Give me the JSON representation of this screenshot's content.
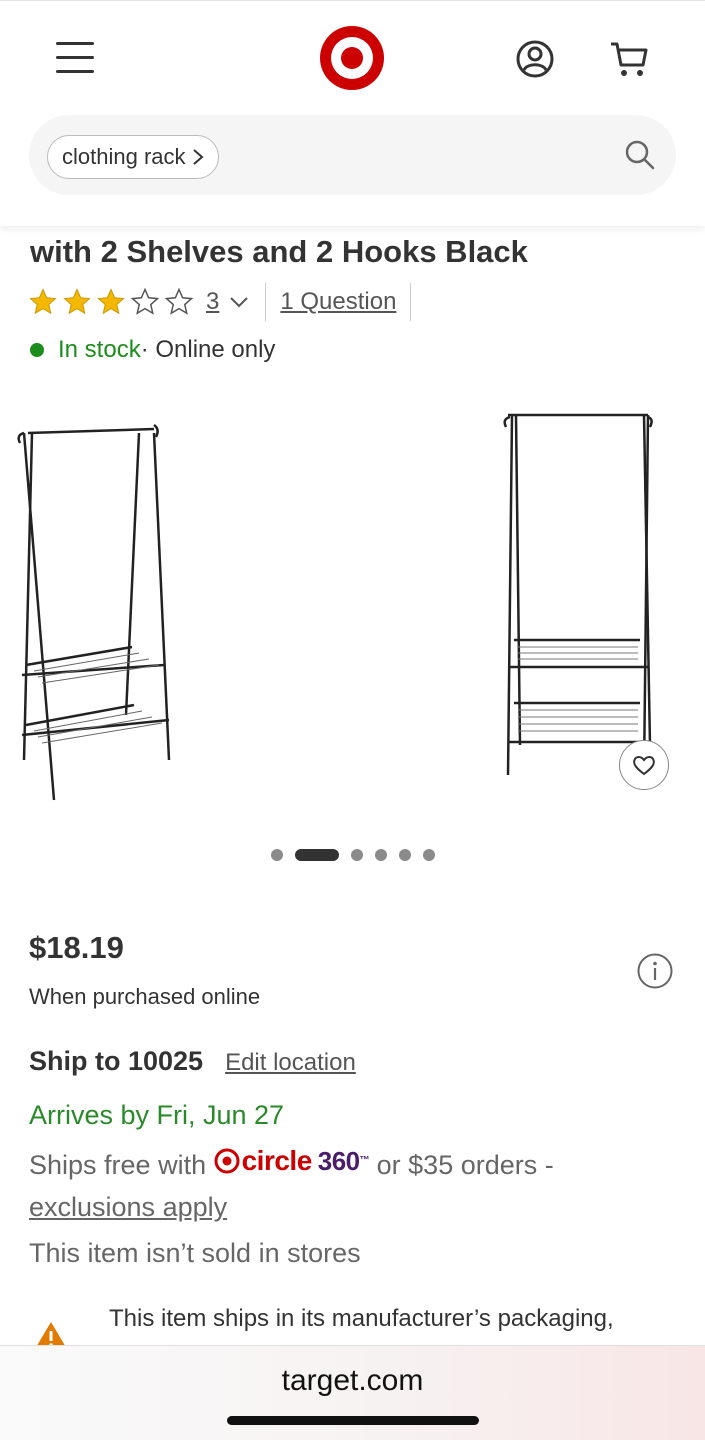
{
  "header": {
    "menu_icon": "hamburger-menu-icon",
    "logo": "target-bullseye-logo",
    "account_icon": "account-icon",
    "cart_icon": "cart-icon"
  },
  "search": {
    "chip_label": "clothing rack",
    "chip_chevron": "›",
    "icon": "search-icon"
  },
  "product": {
    "title": "with 2 Shelves and 2 Hooks Black",
    "rating_value": 3,
    "rating_max": 5,
    "review_count": "3",
    "question_link": "1 Question",
    "stock_status": "In stock",
    "stock_extra": " · Online only",
    "carousel_total": 6,
    "carousel_active_index": 1
  },
  "pricing": {
    "price": "$18.19",
    "price_note": "When purchased online"
  },
  "shipping": {
    "ship_to": "Ship to 10025",
    "edit_location": "Edit location",
    "arrives": "Arrives by Fri, Jun 27",
    "ships_free_prefix": "Ships free with ",
    "circle_word": "circle",
    "circle_number": "360",
    "circle_tm": "™",
    "ships_free_suffix": " or $35 orders - ",
    "exclusions": "exclusions apply",
    "not_sold_in_stores": "This item isn’t sold in stores",
    "warning_text": "This item ships in its manufacturer’s packaging,"
  },
  "browser": {
    "url": "target.com"
  },
  "colors": {
    "brand_red": "#cc0000",
    "stock_green": "#1c8c1c",
    "star_gold": "#f5b800",
    "circle_purple": "#4b1c6b",
    "warning_orange": "#e07b00"
  }
}
